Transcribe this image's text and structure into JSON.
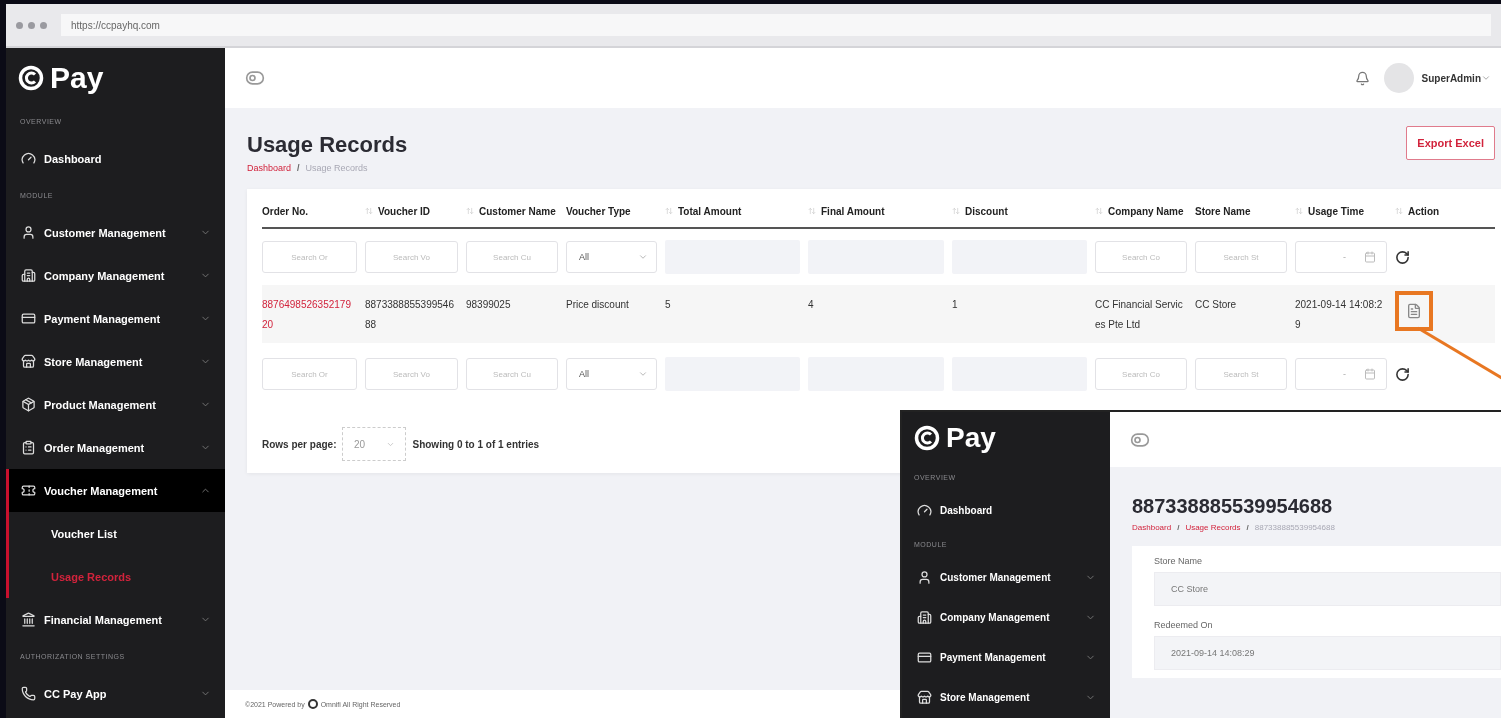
{
  "browser": {
    "url": "https://ccpayhq.com"
  },
  "sidebar": {
    "logo": "Pay",
    "sections": [
      {
        "label": "OVERVIEW",
        "items": [
          {
            "label": "Dashboard"
          }
        ]
      },
      {
        "label": "MODULE",
        "items": [
          {
            "label": "Customer Management",
            "expanded": false
          },
          {
            "label": "Company Management",
            "expanded": false
          },
          {
            "label": "Payment Management",
            "expanded": false
          },
          {
            "label": "Store Management",
            "expanded": false
          },
          {
            "label": "Product Management",
            "expanded": false
          },
          {
            "label": "Order Management",
            "expanded": false
          },
          {
            "label": "Voucher Management",
            "expanded": true,
            "children": [
              {
                "label": "Voucher List",
                "selected": false
              },
              {
                "label": "Usage Records",
                "selected": true
              }
            ]
          },
          {
            "label": "Financial Management",
            "expanded": false
          }
        ]
      },
      {
        "label": "AUTHORIZATION SETTINGS",
        "items": [
          {
            "label": "CC Pay App",
            "expanded": false
          }
        ]
      }
    ]
  },
  "header": {
    "user": "SuperAdmin"
  },
  "page": {
    "title": "Usage Records",
    "separator": "/",
    "breadcrumb": [
      {
        "label": "Dashboard",
        "link": true
      },
      {
        "label": "Usage Records",
        "link": false
      }
    ],
    "export_button": "Export Excel"
  },
  "table": {
    "columns": [
      {
        "label": "Order No.",
        "sortable": false
      },
      {
        "label": "Voucher ID",
        "sortable": true
      },
      {
        "label": "Customer Name",
        "sortable": true
      },
      {
        "label": "Voucher Type",
        "sortable": false
      },
      {
        "label": "Total Amount",
        "sortable": true
      },
      {
        "label": "Final Amount",
        "sortable": true
      },
      {
        "label": "Discount",
        "sortable": true
      },
      {
        "label": "Company Name",
        "sortable": true
      },
      {
        "label": "Store Name",
        "sortable": false
      },
      {
        "label": "Usage Time",
        "sortable": true
      },
      {
        "label": "Action",
        "sortable": true
      }
    ],
    "filter_rows": [
      [
        {
          "kind": "text",
          "placeholder": "Search Or"
        },
        {
          "kind": "text",
          "placeholder": "Search Vo"
        },
        {
          "kind": "text",
          "placeholder": "Search Cu"
        },
        {
          "kind": "select",
          "value": "All"
        },
        {
          "kind": "blank"
        },
        {
          "kind": "blank"
        },
        {
          "kind": "blank"
        },
        {
          "kind": "text",
          "placeholder": "Search Co"
        },
        {
          "kind": "text",
          "placeholder": "Search St"
        },
        {
          "kind": "daterange",
          "separator": "-"
        },
        {
          "kind": "reset"
        }
      ],
      [
        {
          "kind": "text",
          "placeholder": "Search Or"
        },
        {
          "kind": "text",
          "placeholder": "Search Vo"
        },
        {
          "kind": "text",
          "placeholder": "Search Cu"
        },
        {
          "kind": "select",
          "value": "All"
        },
        {
          "kind": "blank"
        },
        {
          "kind": "blank"
        },
        {
          "kind": "blank"
        },
        {
          "kind": "text",
          "placeholder": "Search Co"
        },
        {
          "kind": "text",
          "placeholder": "Search St"
        },
        {
          "kind": "daterange",
          "separator": "-"
        },
        {
          "kind": "reset"
        }
      ]
    ],
    "rows": [
      {
        "cells": [
          "887649852635217920",
          "887338885539954688",
          "98399025",
          "Price discount",
          "5",
          "4",
          "1",
          "CC Financial Services Pte Ltd",
          "CC Store",
          "2021-09-14 14:08:29"
        ]
      }
    ]
  },
  "pagination": {
    "label": "Rows per page:",
    "page_size": "20",
    "summary": "Showing 0 to 1 of 1 entries"
  },
  "footer": {
    "prefix": "©2021 Powered by",
    "brand": "Omnifi All Right Reserved"
  },
  "inset": {
    "logo": "Pay",
    "sections": [
      {
        "label": "OVERVIEW",
        "items": [
          {
            "label": "Dashboard"
          }
        ]
      },
      {
        "label": "MODULE",
        "items": [
          {
            "label": "Customer Management",
            "expanded": false
          },
          {
            "label": "Company Management",
            "expanded": false
          },
          {
            "label": "Payment Management",
            "expanded": false
          },
          {
            "label": "Store Management",
            "expanded": false
          }
        ]
      }
    ],
    "title": "887338885539954688",
    "separator": "/",
    "breadcrumb": [
      {
        "label": "Dashboard",
        "link": true
      },
      {
        "label": "Usage Records",
        "link": true
      },
      {
        "label": "887338885539954688",
        "link": false
      }
    ],
    "fields": [
      {
        "label": "Store Name",
        "value": "CC Store"
      },
      {
        "label": "Redeemed On",
        "value": "2021-09-14 14:08:29"
      }
    ]
  }
}
